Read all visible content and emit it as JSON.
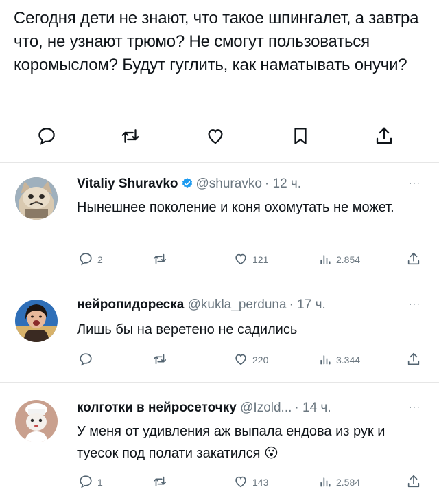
{
  "main_post": {
    "text": "Сегодня дети не знают, что такое шпингалет, а завтра что, не узнают трюмо? Не смогут пользоваться коромыслом? Будут гуглить, как наматывать онучи?",
    "actions": [
      "reply-icon",
      "retweet-icon",
      "like-icon",
      "bookmark-icon",
      "share-icon"
    ]
  },
  "replies": [
    {
      "name": "Vitaliy Shuravko",
      "verified": true,
      "handle": "@shuravko",
      "time": "· 12 ч.",
      "more": "···",
      "text": "Нынешнее поколение и коня охомутать не может.",
      "reply_count": "2",
      "like_count": "121",
      "view_count": "2.854"
    },
    {
      "name": "нейропидореска",
      "verified": false,
      "handle": "@kukla_perduna",
      "time": "· 17 ч.",
      "more": "···",
      "text": "Лишь бы на веретено не садились",
      "reply_count": "",
      "like_count": "220",
      "view_count": "3.344"
    },
    {
      "name": "колготки в нейросеточку",
      "verified": false,
      "handle": "@Izold...",
      "time": "· 14 ч.",
      "more": "···",
      "text": "У меня от удивления аж выпала ендова из рук и туесок под полати закатился",
      "emoji": "😮",
      "reply_count": "1",
      "like_count": "143",
      "view_count": "2.584"
    }
  ],
  "colors": {
    "text": "#0f1419",
    "secondary": "#6b7780",
    "verified_blue": "#1d9bf0",
    "separator": "#e6e6e6"
  }
}
